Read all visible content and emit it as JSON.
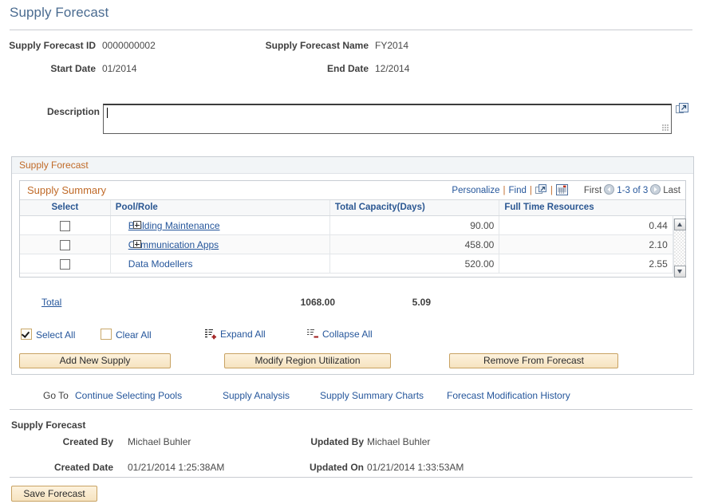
{
  "page": {
    "title": "Supply Forecast"
  },
  "header": {
    "fields": [
      {
        "label": "Supply Forecast ID",
        "value": "0000000002"
      },
      {
        "label": "Supply Forecast Name",
        "value": "FY2014"
      },
      {
        "label": "Start Date",
        "value": "01/2014"
      },
      {
        "label": "End Date",
        "value": "12/2014"
      }
    ],
    "description_label": "Description",
    "description_value": "",
    "expand_icon": "expand-to-new-window-icon"
  },
  "group": {
    "title": "Supply Forecast"
  },
  "grid": {
    "title": "Supply Summary",
    "toolbar": {
      "personalize": "Personalize",
      "find": "Find",
      "separator": "|",
      "new_window_icon": "new-window-icon",
      "download_icon": "download-to-spreadsheet-icon"
    },
    "pager": {
      "first": "First",
      "prev_icon": "previous-page-icon",
      "range": "1-3 of 3",
      "next_icon": "next-page-icon",
      "last": "Last"
    },
    "columns": [
      "Select",
      "Pool/Role",
      "Total Capacity(Days)",
      "Full Time Resources"
    ],
    "rows": [
      {
        "select": false,
        "expandable": true,
        "pool": "Building Maintenance",
        "capacity": "90.00",
        "ftr": "0.44"
      },
      {
        "select": false,
        "expandable": true,
        "pool": "Communication Apps",
        "capacity": "458.00",
        "ftr": "2.10"
      },
      {
        "select": false,
        "expandable": false,
        "pool": "Data Modellers",
        "capacity": "520.00",
        "ftr": "2.55"
      }
    ],
    "total": {
      "label": "Total",
      "capacity": "1068.00",
      "ftr": "5.09"
    }
  },
  "controls": {
    "select_all": "Select All",
    "clear_all": "Clear All",
    "expand_all": "Expand All",
    "collapse_all": "Collapse All"
  },
  "buttons": {
    "add_new_supply": "Add New Supply",
    "modify_region_utilization": "Modify Region Utilization",
    "remove_from_forecast": "Remove From Forecast",
    "save_forecast": "Save Forecast"
  },
  "goto": {
    "label": "Go To",
    "links": [
      "Continue Selecting Pools",
      "Supply Analysis",
      "Supply Summary Charts",
      "Forecast Modification History"
    ]
  },
  "footer": {
    "title": "Supply Forecast",
    "fields": [
      {
        "label": "Created By",
        "value": "Michael Buhler"
      },
      {
        "label": "Updated By",
        "value": "Michael Buhler"
      },
      {
        "label": "Created Date",
        "value": "01/21/2014  1:25:38AM"
      },
      {
        "label": "Updated On",
        "value": "01/21/2014  1:33:53AM"
      }
    ]
  },
  "colors": {
    "title_blue": "#4a6b90",
    "group_header_orange": "#c06a28",
    "link_blue": "#25569b",
    "column_header_blue": "#2b5792",
    "button_gold": "#c8a262",
    "accent_red": "#a01c1c"
  }
}
